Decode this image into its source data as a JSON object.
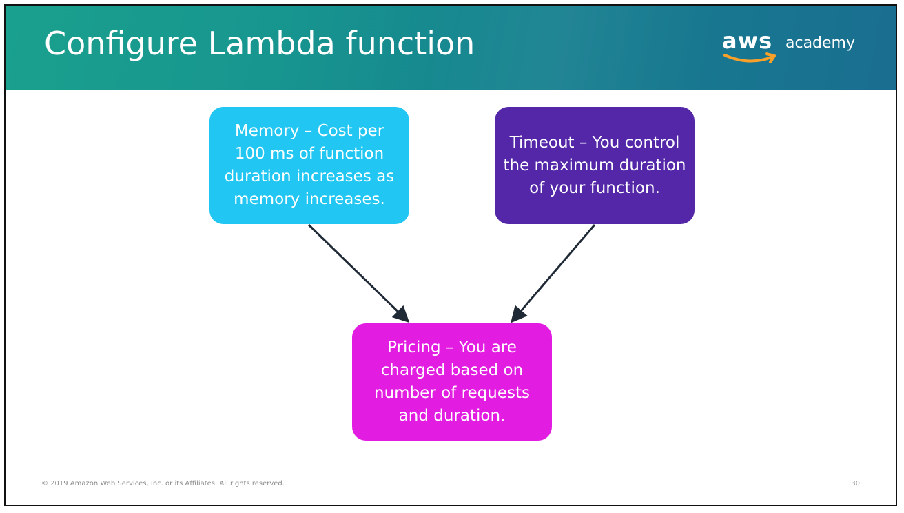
{
  "header": {
    "title": "Configure Lambda function",
    "logo": {
      "brand": "aws",
      "suffix": "academy"
    }
  },
  "diagram": {
    "nodes": {
      "memory": "Memory – Cost per 100 ms of function duration increases as memory increases.",
      "timeout": "Timeout – You control the maximum duration of your function.",
      "pricing": "Pricing – You are charged based on number of requests and duration."
    },
    "edges": [
      {
        "from": "memory",
        "to": "pricing"
      },
      {
        "from": "timeout",
        "to": "pricing"
      }
    ]
  },
  "footer": {
    "copyright": "© 2019 Amazon Web Services, Inc. or its Affiliates. All rights reserved.",
    "page_number": "30"
  },
  "colors": {
    "header_start": "#1aa08e",
    "header_end": "#1a6e90",
    "memory": "#21c6f2",
    "timeout": "#5327a8",
    "pricing": "#e21ce1",
    "arrow": "#1f2a36",
    "logo_smile": "#f7a12b"
  }
}
